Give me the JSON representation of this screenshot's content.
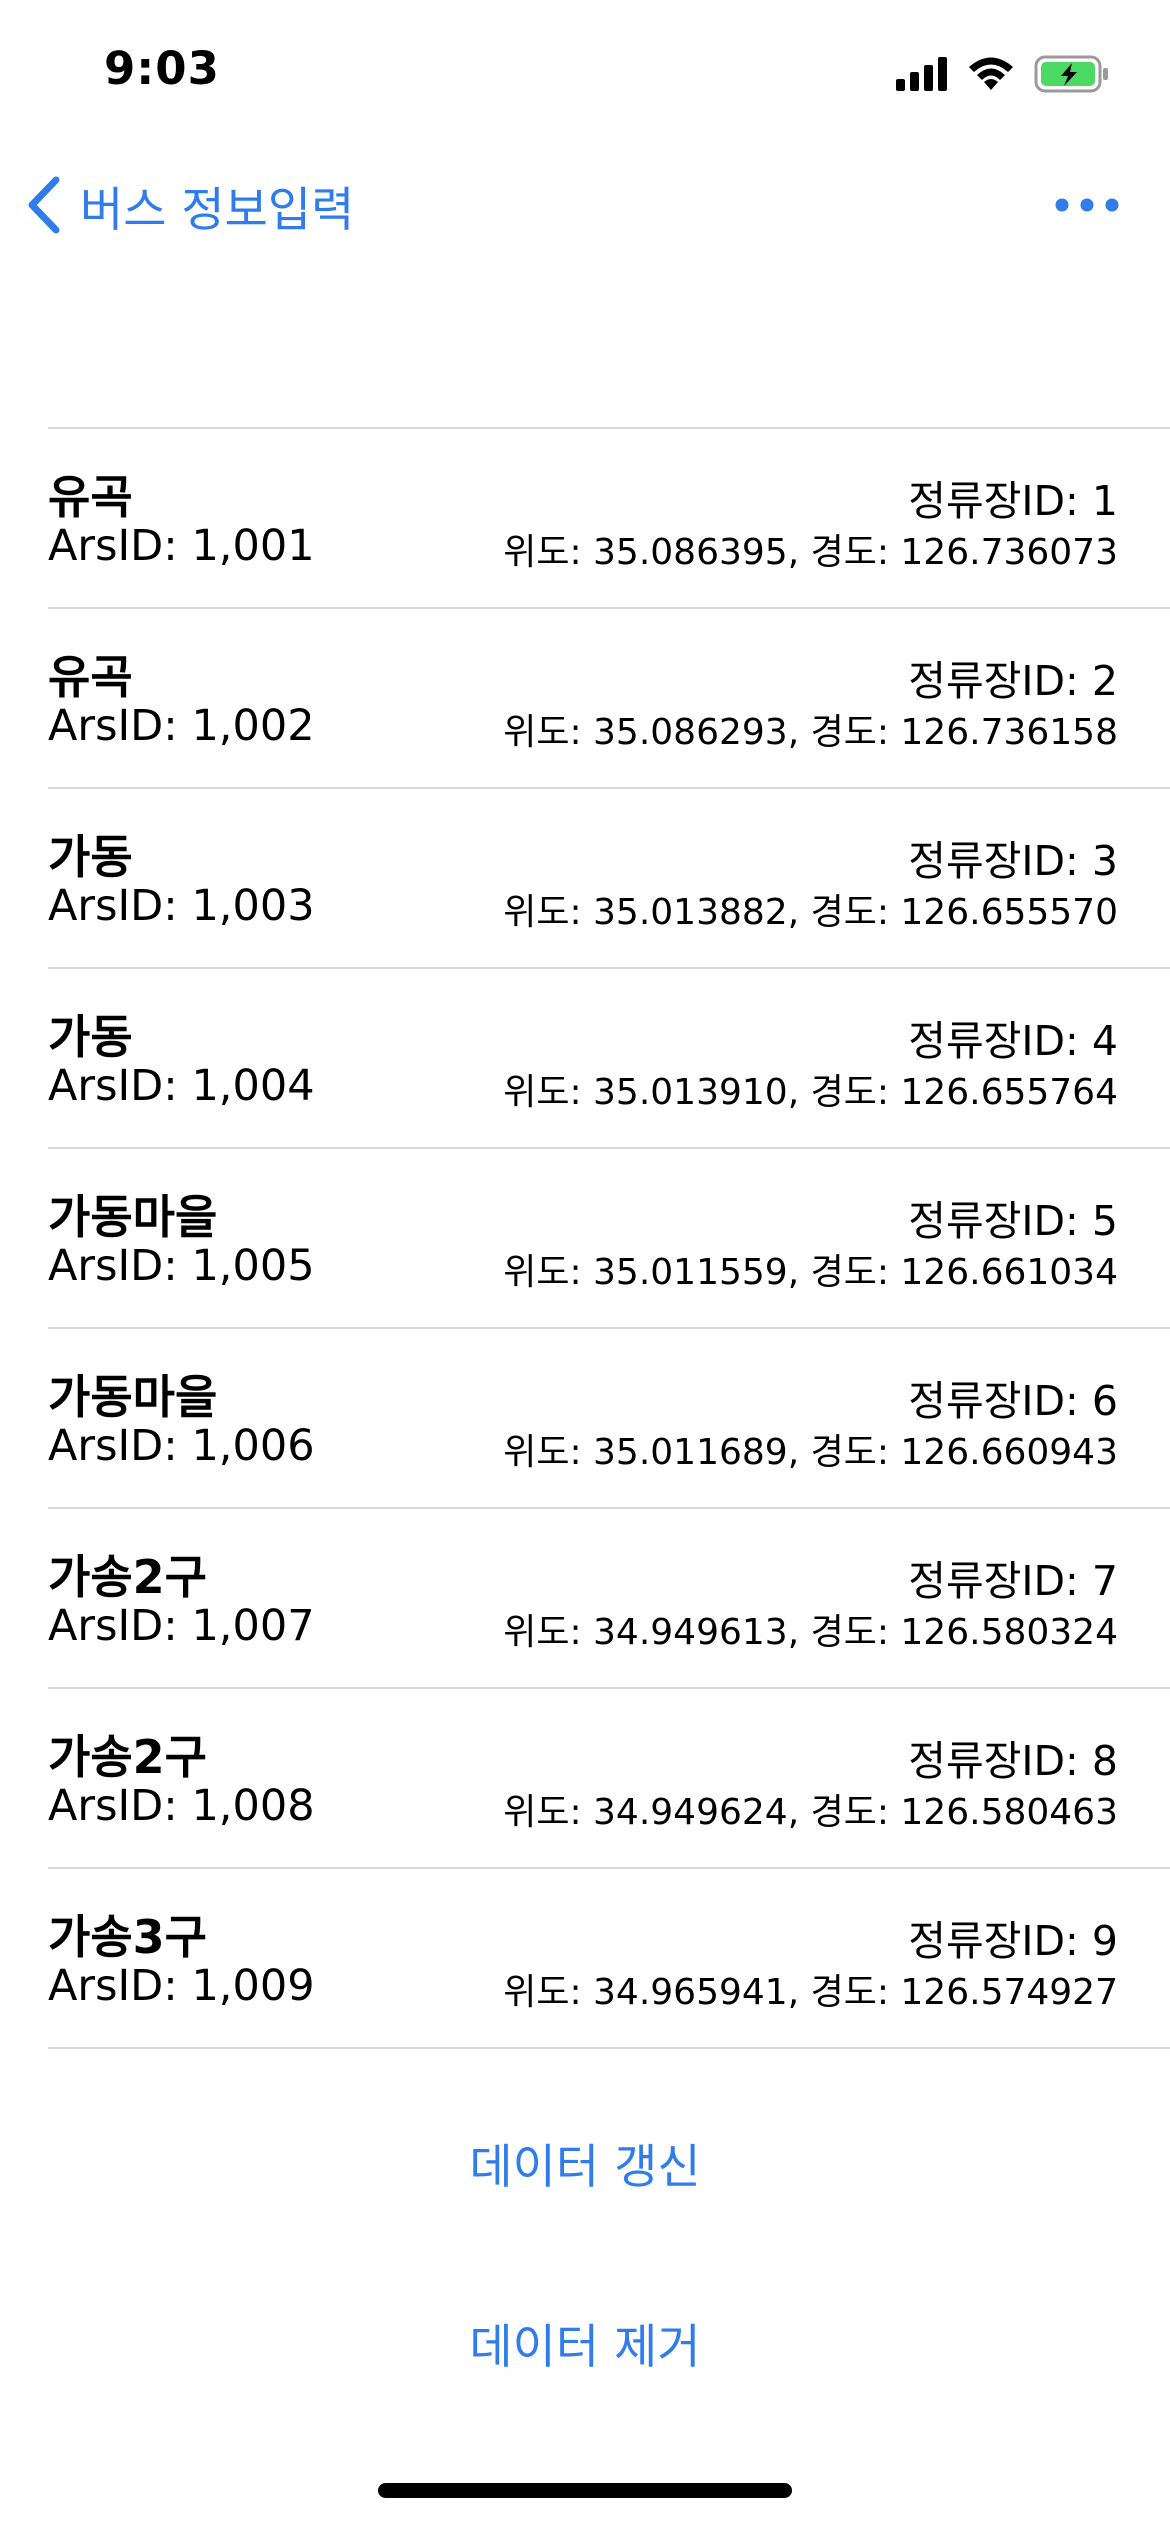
{
  "status_bar": {
    "time": "9:03",
    "icons": [
      "cellular-signal-icon",
      "wifi-icon",
      "battery-charging-icon"
    ],
    "battery_color": "#4CD964"
  },
  "nav": {
    "back_label": "버스 정보입력",
    "back_icon": "chevron-left-icon",
    "more_icon": "ellipsis-icon",
    "accent_color": "#2F7CEA"
  },
  "stops": [
    {
      "name": "유곡",
      "ars": "ArsID: 1,001",
      "stop_id": "정류장ID: 1",
      "coords": "위도: 35.086395, 경도: 126.736073"
    },
    {
      "name": "유곡",
      "ars": "ArsID: 1,002",
      "stop_id": "정류장ID: 2",
      "coords": "위도: 35.086293, 경도: 126.736158"
    },
    {
      "name": "가동",
      "ars": "ArsID: 1,003",
      "stop_id": "정류장ID: 3",
      "coords": "위도: 35.013882, 경도: 126.655570"
    },
    {
      "name": "가동",
      "ars": "ArsID: 1,004",
      "stop_id": "정류장ID: 4",
      "coords": "위도: 35.013910, 경도: 126.655764"
    },
    {
      "name": "가동마을",
      "ars": "ArsID: 1,005",
      "stop_id": "정류장ID: 5",
      "coords": "위도: 35.011559, 경도: 126.661034"
    },
    {
      "name": "가동마을",
      "ars": "ArsID: 1,006",
      "stop_id": "정류장ID: 6",
      "coords": "위도: 35.011689, 경도: 126.660943"
    },
    {
      "name": "가송2구",
      "ars": "ArsID: 1,007",
      "stop_id": "정류장ID: 7",
      "coords": "위도: 34.949613, 경도: 126.580324"
    },
    {
      "name": "가송2구",
      "ars": "ArsID: 1,008",
      "stop_id": "정류장ID: 8",
      "coords": "위도: 34.949624, 경도: 126.580463"
    },
    {
      "name": "가송3구",
      "ars": "ArsID: 1,009",
      "stop_id": "정류장ID: 9",
      "coords": "위도: 34.965941, 경도: 126.574927"
    }
  ],
  "actions": {
    "refresh_label": "데이터 갱신",
    "remove_label": "데이터 제거"
  }
}
